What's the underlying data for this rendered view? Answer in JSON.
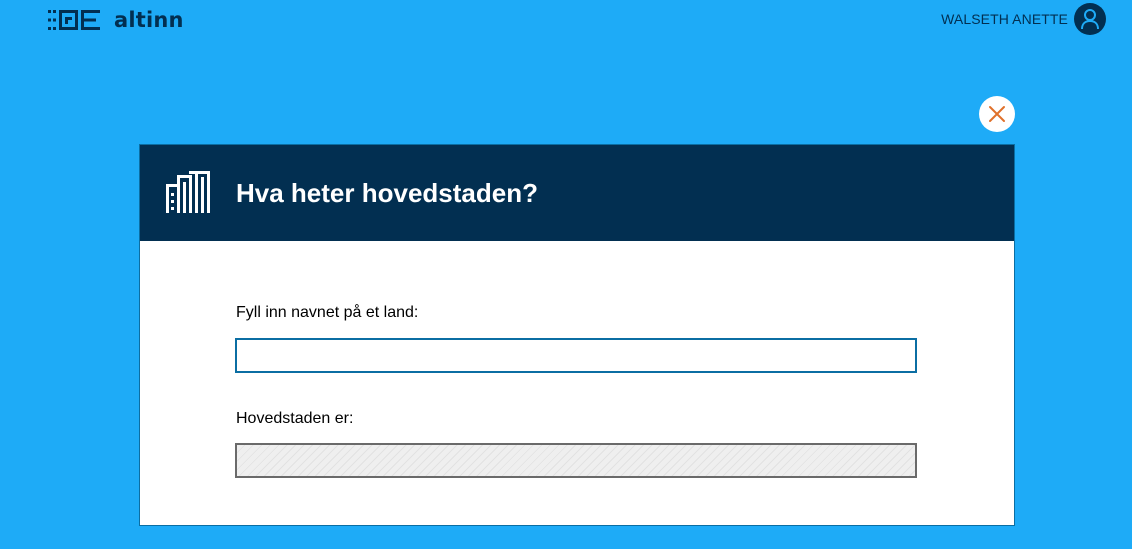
{
  "header": {
    "brand_name": "altinn",
    "user_name": "WALSETH ANETTE",
    "icons": {
      "logo": "altinn-logo-icon",
      "avatar": "user-avatar-icon"
    }
  },
  "modal": {
    "title": "Hva heter hovedstaden?",
    "header_icon": "building-icon",
    "close_icon": "close-icon",
    "fields": [
      {
        "label": "Fyll inn navnet på et land:",
        "value": "",
        "readonly": false
      },
      {
        "label": "Hovedstaden er:",
        "value": "",
        "readonly": true
      }
    ]
  },
  "colors": {
    "background": "#1eabf7",
    "header_dark": "#022f51",
    "close_icon": "#e0702a",
    "input_border": "#0b6ea3"
  }
}
